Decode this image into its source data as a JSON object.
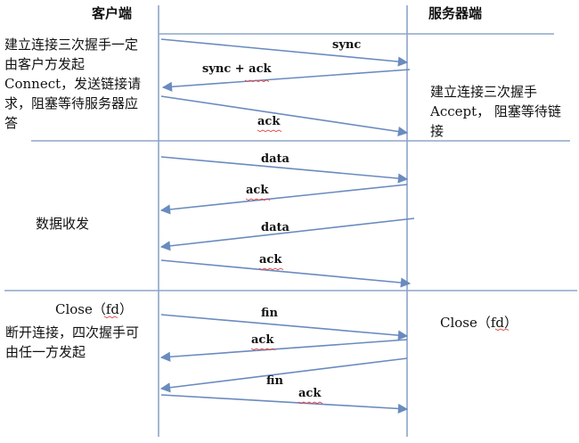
{
  "headers": {
    "client": "客户端",
    "server": "服务器端"
  },
  "handshake": {
    "client_note": "建立连接三次握手一定由客户方发起Connect，发送链接请求，阻塞等待服务器应答",
    "server_note": "建立连接三次握手Accept， 阻塞等待链接",
    "messages": [
      {
        "label": "sync",
        "from": "client",
        "to": "server"
      },
      {
        "label": "sync + ack",
        "from": "server",
        "to": "client"
      },
      {
        "label": "ack",
        "from": "client",
        "to": "server"
      }
    ]
  },
  "transfer": {
    "client_note": "数据收发",
    "messages": [
      {
        "label": "data",
        "from": "client",
        "to": "server"
      },
      {
        "label": "ack",
        "from": "server",
        "to": "client"
      },
      {
        "label": "data",
        "from": "server",
        "to": "client"
      },
      {
        "label": "ack",
        "from": "client",
        "to": "server"
      }
    ]
  },
  "teardown": {
    "client_call": "Close（fd）",
    "client_note": "断开连接，四次握手可由任一方发起",
    "server_call": "Close（fd）",
    "messages": [
      {
        "label": "fin",
        "from": "client",
        "to": "server"
      },
      {
        "label": "ack",
        "from": "server",
        "to": "client"
      },
      {
        "label": "fin",
        "from": "server",
        "to": "client"
      },
      {
        "label": "ack",
        "from": "client",
        "to": "server"
      }
    ]
  },
  "colors": {
    "line": "#8ea5c9",
    "arrow": "#6a8bbf",
    "squiggle": "#e04040"
  }
}
